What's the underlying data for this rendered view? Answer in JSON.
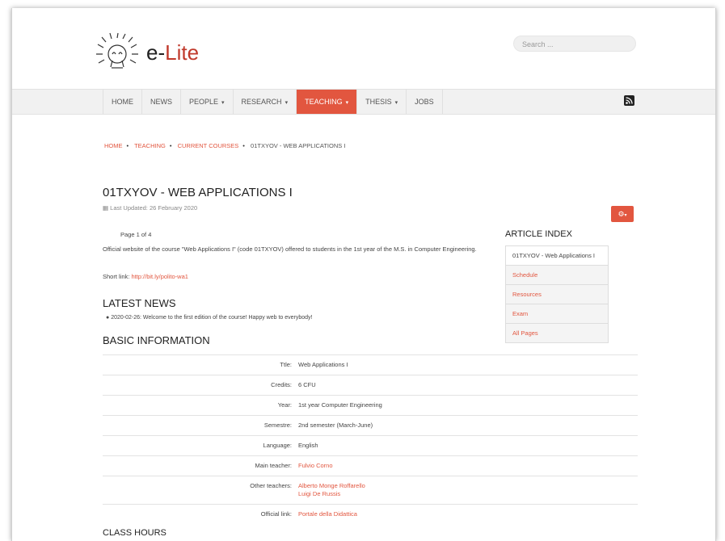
{
  "header": {
    "logo_prefix": "e-",
    "logo_suffix": "Lite",
    "search_placeholder": "Search ..."
  },
  "nav": {
    "items": [
      {
        "label": "HOME"
      },
      {
        "label": "NEWS"
      },
      {
        "label": "PEOPLE",
        "caret": "⌄"
      },
      {
        "label": "RESEARCH",
        "caret": "⌄"
      },
      {
        "label": "TEACHING",
        "caret": "⌄",
        "active": true
      },
      {
        "label": "THESIS",
        "caret": "⌄"
      },
      {
        "label": "JOBS"
      }
    ],
    "rss_icon": "rss-icon"
  },
  "breadcrumb": {
    "items": [
      "HOME",
      "TEACHING",
      "CURRENT COURSES"
    ],
    "current": "01TXYOV - WEB APPLICATIONS I"
  },
  "article": {
    "title": "01TXYOV - WEB APPLICATIONS I",
    "last_updated": "Last Updated: 26 February 2020",
    "page_number": "Page 1 of 4",
    "intro": "Official website of the course \"Web Applications I\" (code 01TXYOV) offered to students in the 1st year of the M.S. in Computer Engineering.",
    "short_link_label": "Short link:",
    "short_link": "http://bit.ly/polito-wa1",
    "latest_news_heading": "LATEST NEWS",
    "news_item": "2020-02-26: Welcome to the first edition of the course! Happy web to everybody!",
    "basic_info_heading": "BASIC INFORMATION",
    "class_hours_heading": "CLASS HOURS"
  },
  "info_table": {
    "title_label": "Ttle:",
    "title_value": "Web Applications I",
    "credits_label": "Credits:",
    "credits_value": "6 CFU",
    "year_label": "Year:",
    "year_value": "1st year Computer Engineering",
    "semester_label": "Semestre:",
    "semester_value": "2nd semester (March-June)",
    "language_label": "Language:",
    "language_value": "English",
    "main_teacher_label": "Main teacher:",
    "main_teacher_value": "Fulvio Corno",
    "other_teachers_label": "Other teachers:",
    "other_teacher_1": "Alberto Monge Roffarello",
    "other_teacher_2": "Luigi De Russis",
    "official_link_label": "Official link:",
    "official_link_value": "Portale della Didattica"
  },
  "article_index": {
    "heading": "ARTICLE INDEX",
    "items": [
      "01TXYOV - Web Applications I",
      "Schedule",
      "Resources",
      "Exam",
      "All Pages"
    ]
  },
  "colors": {
    "accent": "#e2563f",
    "nav_bg": "#f1f1f1"
  }
}
